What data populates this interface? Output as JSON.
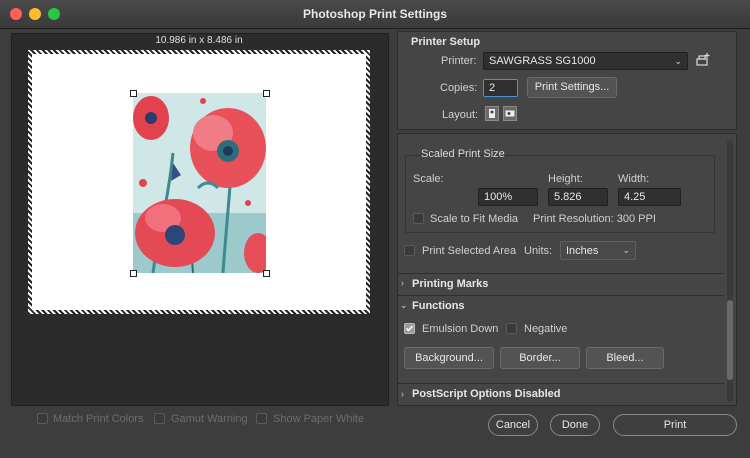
{
  "window": {
    "title": "Photoshop Print Settings",
    "traffic_colors": [
      "#ff5f57",
      "#febc2e",
      "#28c840"
    ]
  },
  "preview": {
    "paper_size": "10.986 in x 8.486 in"
  },
  "bottom_left": {
    "match_print_colors": "Match Print Colors",
    "gamut_warning": "Gamut Warning",
    "show_paper_white": "Show Paper White"
  },
  "printer_setup": {
    "header": "Printer Setup",
    "printer_label": "Printer:",
    "printer_value": "SAWGRASS SG1000",
    "copies_label": "Copies:",
    "copies_value": "2",
    "print_settings_button": "Print Settings...",
    "layout_label": "Layout:"
  },
  "scaled_print_size": {
    "header": "Scaled Print Size",
    "scale_label": "Scale:",
    "height_label": "Height:",
    "width_label": "Width:",
    "scale_value": "100%",
    "height_value": "5.826",
    "width_value": "4.25",
    "scale_to_fit": "Scale to Fit Media",
    "print_resolution": "Print Resolution: 300 PPI",
    "print_selected_area": "Print Selected Area",
    "units_label": "Units:",
    "units_value": "Inches"
  },
  "printing_marks": {
    "header": "Printing Marks"
  },
  "functions": {
    "header": "Functions",
    "emulsion_down": "Emulsion Down",
    "emulsion_down_checked": true,
    "negative": "Negative",
    "background_button": "Background...",
    "border_button": "Border...",
    "bleed_button": "Bleed..."
  },
  "postscript": {
    "header": "PostScript Options Disabled"
  },
  "footer": {
    "cancel": "Cancel",
    "done": "Done",
    "print": "Print"
  }
}
